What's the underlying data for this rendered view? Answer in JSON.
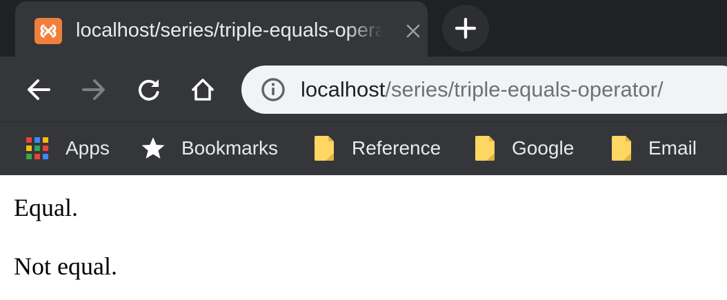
{
  "browser": {
    "tab": {
      "title": "localhost/series/triple-equals-operator/",
      "favicon": "xampp-icon",
      "close_icon": "close-icon"
    },
    "new_tab_icon": "plus-icon",
    "toolbar": {
      "back_icon": "arrow-left-icon",
      "forward_icon": "arrow-right-icon",
      "reload_icon": "reload-icon",
      "home_icon": "home-icon",
      "site_info_icon": "info-icon",
      "url_host": "localhost",
      "url_path": "/series/triple-equals-operator/"
    },
    "bookmarks": [
      {
        "label": "Apps",
        "icon": "apps-grid-icon"
      },
      {
        "label": "Bookmarks",
        "icon": "star-icon"
      },
      {
        "label": "Reference",
        "icon": "folder-icon"
      },
      {
        "label": "Google",
        "icon": "folder-icon"
      },
      {
        "label": "Email",
        "icon": "folder-icon"
      }
    ]
  },
  "page": {
    "lines": [
      "Equal.",
      "Not equal."
    ]
  },
  "colors": {
    "tabstrip_bg": "#202124",
    "toolbar_bg": "#35363a",
    "omnibox_bg": "#f1f3f4",
    "favicon_orange": "#f07f3c",
    "folder_yellow": "#fdd663"
  }
}
